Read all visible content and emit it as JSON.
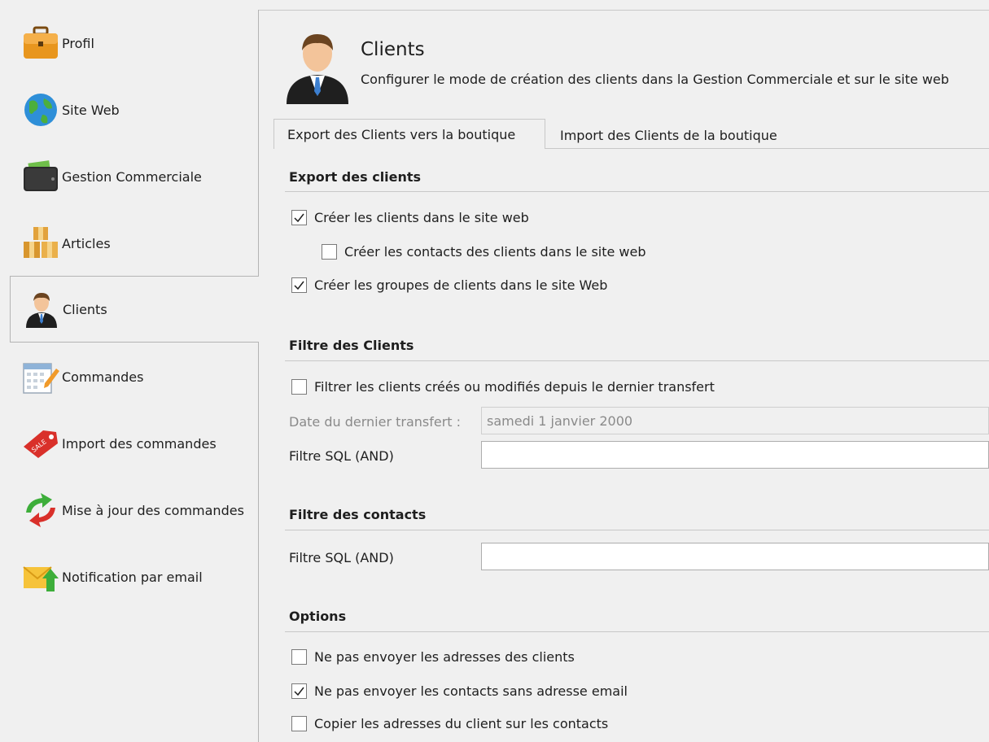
{
  "sidebar": {
    "items": [
      {
        "label": "Profil",
        "icon": "briefcase-icon"
      },
      {
        "label": "Site Web",
        "icon": "globe-icon"
      },
      {
        "label": "Gestion Commerciale",
        "icon": "wallet-icon"
      },
      {
        "label": "Articles",
        "icon": "boxes-icon"
      },
      {
        "label": "Clients",
        "icon": "client-icon",
        "selected": true
      },
      {
        "label": "Commandes",
        "icon": "calendar-edit-icon"
      },
      {
        "label": "Import des commandes",
        "icon": "sale-tag-icon"
      },
      {
        "label": "Mise à jour des commandes",
        "icon": "refresh-arrows-icon"
      },
      {
        "label": "Notification par email",
        "icon": "mail-upload-icon"
      }
    ]
  },
  "header": {
    "title": "Clients",
    "subtitle": "Configurer le mode de création des clients dans la Gestion Commerciale et sur le site web"
  },
  "tabs": [
    {
      "label": "Export des Clients vers la boutique",
      "active": true
    },
    {
      "label": "Import des Clients de la boutique",
      "active": false
    }
  ],
  "export_section": {
    "title": "Export des clients",
    "options": [
      {
        "label": "Créer les clients dans le site web",
        "checked": true
      },
      {
        "label": "Créer les contacts des clients dans le site web",
        "checked": false
      },
      {
        "label": "Créer les groupes de clients dans le site Web",
        "checked": true
      }
    ]
  },
  "client_filter": {
    "title": "Filtre des Clients",
    "filter_checkbox": {
      "label": "Filtrer les clients créés ou modifiés depuis le dernier transfert",
      "checked": false
    },
    "date_label": "Date du dernier transfert :",
    "date_value": "samedi 1 janvier 2000",
    "sql_label": "Filtre SQL (AND)",
    "sql_value": ""
  },
  "contact_filter": {
    "title": "Filtre des contacts",
    "sql_label": "Filtre SQL (AND)",
    "sql_value": ""
  },
  "options_section": {
    "title": "Options",
    "options": [
      {
        "label": "Ne pas envoyer les adresses des clients",
        "checked": false
      },
      {
        "label": "Ne pas envoyer les contacts sans adresse email",
        "checked": true
      },
      {
        "label": "Copier les adresses du client sur les contacts",
        "checked": false
      }
    ]
  },
  "colors": {
    "background": "#f0f0f0",
    "border": "#c8c8c8",
    "text": "#1e1e1e",
    "disabled_text": "#8a8a8a"
  }
}
